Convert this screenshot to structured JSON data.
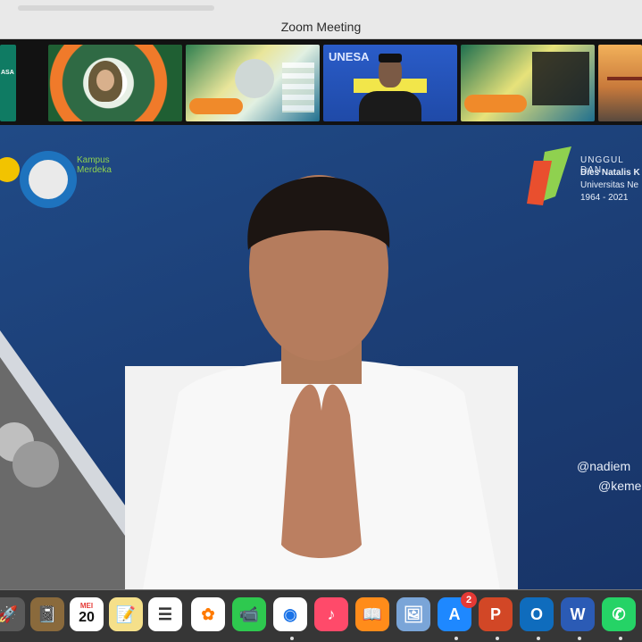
{
  "window": {
    "title": "Zoom Meeting"
  },
  "gallery": {
    "tiles": [
      {
        "name": "tile-unesa-left",
        "label": "ASA"
      },
      {
        "name": "tile-woman-hijab",
        "label": ""
      },
      {
        "name": "tile-event-poster",
        "label": ""
      },
      {
        "name": "tile-unesa-rector",
        "label": "UNESA"
      },
      {
        "name": "tile-event-poster-2",
        "label": ""
      },
      {
        "name": "tile-bridge",
        "label": ""
      }
    ]
  },
  "main": {
    "logo_text": "Kampus\nMerdeka",
    "badge": {
      "line1": "UNGGUL DAN",
      "line2": "Dies Natalis K",
      "line3": "Universitas Ne",
      "line4": "1964 - 2021"
    },
    "handles": [
      "@nadiem",
      "@keme"
    ]
  },
  "dock": {
    "items": [
      {
        "name": "launchpad-icon",
        "glyph": "🚀",
        "color": "#5a5a5a"
      },
      {
        "name": "notes-book-icon",
        "glyph": "📓",
        "color": "#8a6a3c"
      },
      {
        "name": "calendar-icon",
        "glyph": "20",
        "color": "#ffffff"
      },
      {
        "name": "notes-icon",
        "glyph": "📝",
        "color": "#f5e08a"
      },
      {
        "name": "reminders-icon",
        "glyph": "☰",
        "color": "#ffffff"
      },
      {
        "name": "photos-icon",
        "glyph": "✿",
        "color": "#ffffff"
      },
      {
        "name": "facetime-icon",
        "glyph": "📹",
        "color": "#2ec94f"
      },
      {
        "name": "chrome-icon",
        "glyph": "◉",
        "color": "#ffffff"
      },
      {
        "name": "music-icon",
        "glyph": "♪",
        "color": "#ff4a6a"
      },
      {
        "name": "books-icon",
        "glyph": "📖",
        "color": "#ff8c1a"
      },
      {
        "name": "preview-icon",
        "glyph": "🖼",
        "color": "#7aa5d8"
      },
      {
        "name": "appstore-icon",
        "glyph": "A",
        "color": "#1e88ff"
      },
      {
        "name": "powerpoint-icon",
        "glyph": "P",
        "color": "#d24726"
      },
      {
        "name": "outlook-icon",
        "glyph": "O",
        "color": "#0f6cbd"
      },
      {
        "name": "word-icon",
        "glyph": "W",
        "color": "#2b5bb5"
      },
      {
        "name": "whatsapp-icon",
        "glyph": "✆",
        "color": "#25d366"
      }
    ],
    "calendar_month": "MEI",
    "appstore_badge": "2"
  }
}
